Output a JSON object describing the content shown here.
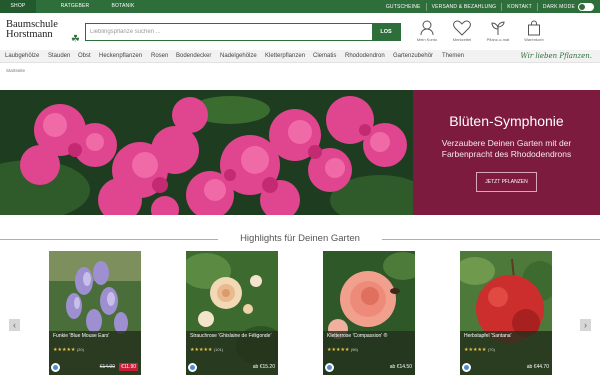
{
  "topbar": {
    "tabs": [
      "SHOP",
      "RATGEBER",
      "BOTANIK"
    ],
    "links": [
      "GUTSCHEINE",
      "VERSAND & BEZAHLUNG",
      "KONTAKT"
    ],
    "darkmode_label": "DARK MODE"
  },
  "header": {
    "logo_line1": "Baumschule",
    "logo_line2": "Horstmann",
    "search_placeholder": "Lieblingspflanze suchen ...",
    "search_button": "LOS",
    "icons": [
      {
        "name": "account-icon",
        "label": "Mein Konto"
      },
      {
        "name": "heart-icon",
        "label": "Merkzettel"
      },
      {
        "name": "plant-o-mat-icon",
        "label": "Pflanz-o-mat"
      },
      {
        "name": "cart-icon",
        "label": "Warenkorb"
      }
    ]
  },
  "nav": {
    "items": [
      "Laubgehölze",
      "Stauden",
      "Obst",
      "Heckenpflanzen",
      "Rosen",
      "Bodendecker",
      "Nadelgehölze",
      "Kletterpflanzen",
      "Clematis",
      "Rhododendron",
      "Gartenzubehör",
      "Themen"
    ],
    "slogan": "Wir lieben Pflanzen."
  },
  "breadcrumb": "Startseite",
  "hero": {
    "title": "Blüten-Symphonie",
    "subtitle": "Verzaubere Deinen Garten mit der Farbenpracht des Rhododendrons",
    "button": "JETZT PFLANZEN"
  },
  "highlights": {
    "title": "Highlights für Deinen Garten",
    "products": [
      {
        "name": "Funkie 'Blue Mouse Ears'",
        "stars": "★★★★★",
        "count": "(20)",
        "price_old": "€14.90",
        "price": "€11.90",
        "sale": true
      },
      {
        "name": "Strauchrose 'Ghislaine de Féligonde'",
        "stars": "★★★★★",
        "count": "(101)",
        "price": "ab €15.20",
        "sale": false
      },
      {
        "name": "Kletterrose 'Compassion' ®",
        "stars": "★★★★★",
        "count": "(96)",
        "price": "ab €14.50",
        "sale": false
      },
      {
        "name": "Herbstapfel 'Santana'",
        "stars": "★★★★★",
        "count": "(70)",
        "price": "ab €44.70",
        "sale": false
      }
    ]
  },
  "colors": {
    "brand_green": "#2e6e3a",
    "hero_panel": "#7d1b3f",
    "sale_red": "#c61e38"
  }
}
